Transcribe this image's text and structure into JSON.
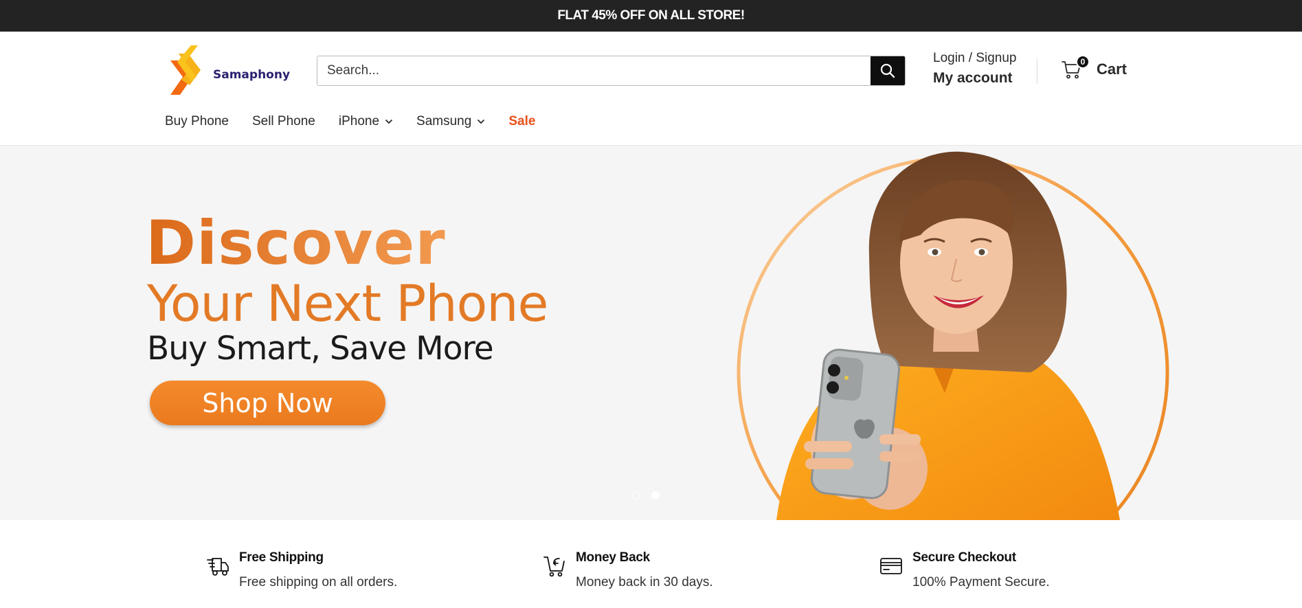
{
  "promo": {
    "text": "FLAT 45% OFF ON ALL STORE!"
  },
  "brand": {
    "name": "Samaphony",
    "logo_icon": "double-chevron-logo"
  },
  "search": {
    "placeholder": "Search...",
    "value": "",
    "button_icon": "search-icon"
  },
  "account": {
    "login_label": "Login / Signup",
    "my_account_label": "My account"
  },
  "cart": {
    "count": "0",
    "label": "Cart",
    "icon": "cart-icon"
  },
  "nav": {
    "items": [
      {
        "label": "Buy Phone",
        "dropdown": false
      },
      {
        "label": "Sell Phone",
        "dropdown": false
      },
      {
        "label": "iPhone",
        "dropdown": true
      },
      {
        "label": "Samsung",
        "dropdown": true
      },
      {
        "label": "Sale",
        "dropdown": false,
        "highlight": "#e8501a"
      }
    ]
  },
  "hero": {
    "title": "Discover",
    "subtitle": "Your Next Phone",
    "tagline": "Buy Smart, Save More",
    "cta_label": "Shop Now",
    "slides_total": 2,
    "active_slide": 2
  },
  "features": [
    {
      "icon": "shipping-truck-icon",
      "title": "Free Shipping",
      "desc": "Free shipping on all orders."
    },
    {
      "icon": "cart-return-icon",
      "title": "Money Back",
      "desc": "Money back in 30 days."
    },
    {
      "icon": "credit-card-icon",
      "title": "Secure Checkout",
      "desc": "100% Payment Secure."
    }
  ],
  "colors": {
    "accent_orange": "#e37a26",
    "sale_red": "#e8501a",
    "promo_bg": "#232323",
    "brand_purple": "#2b2170"
  }
}
